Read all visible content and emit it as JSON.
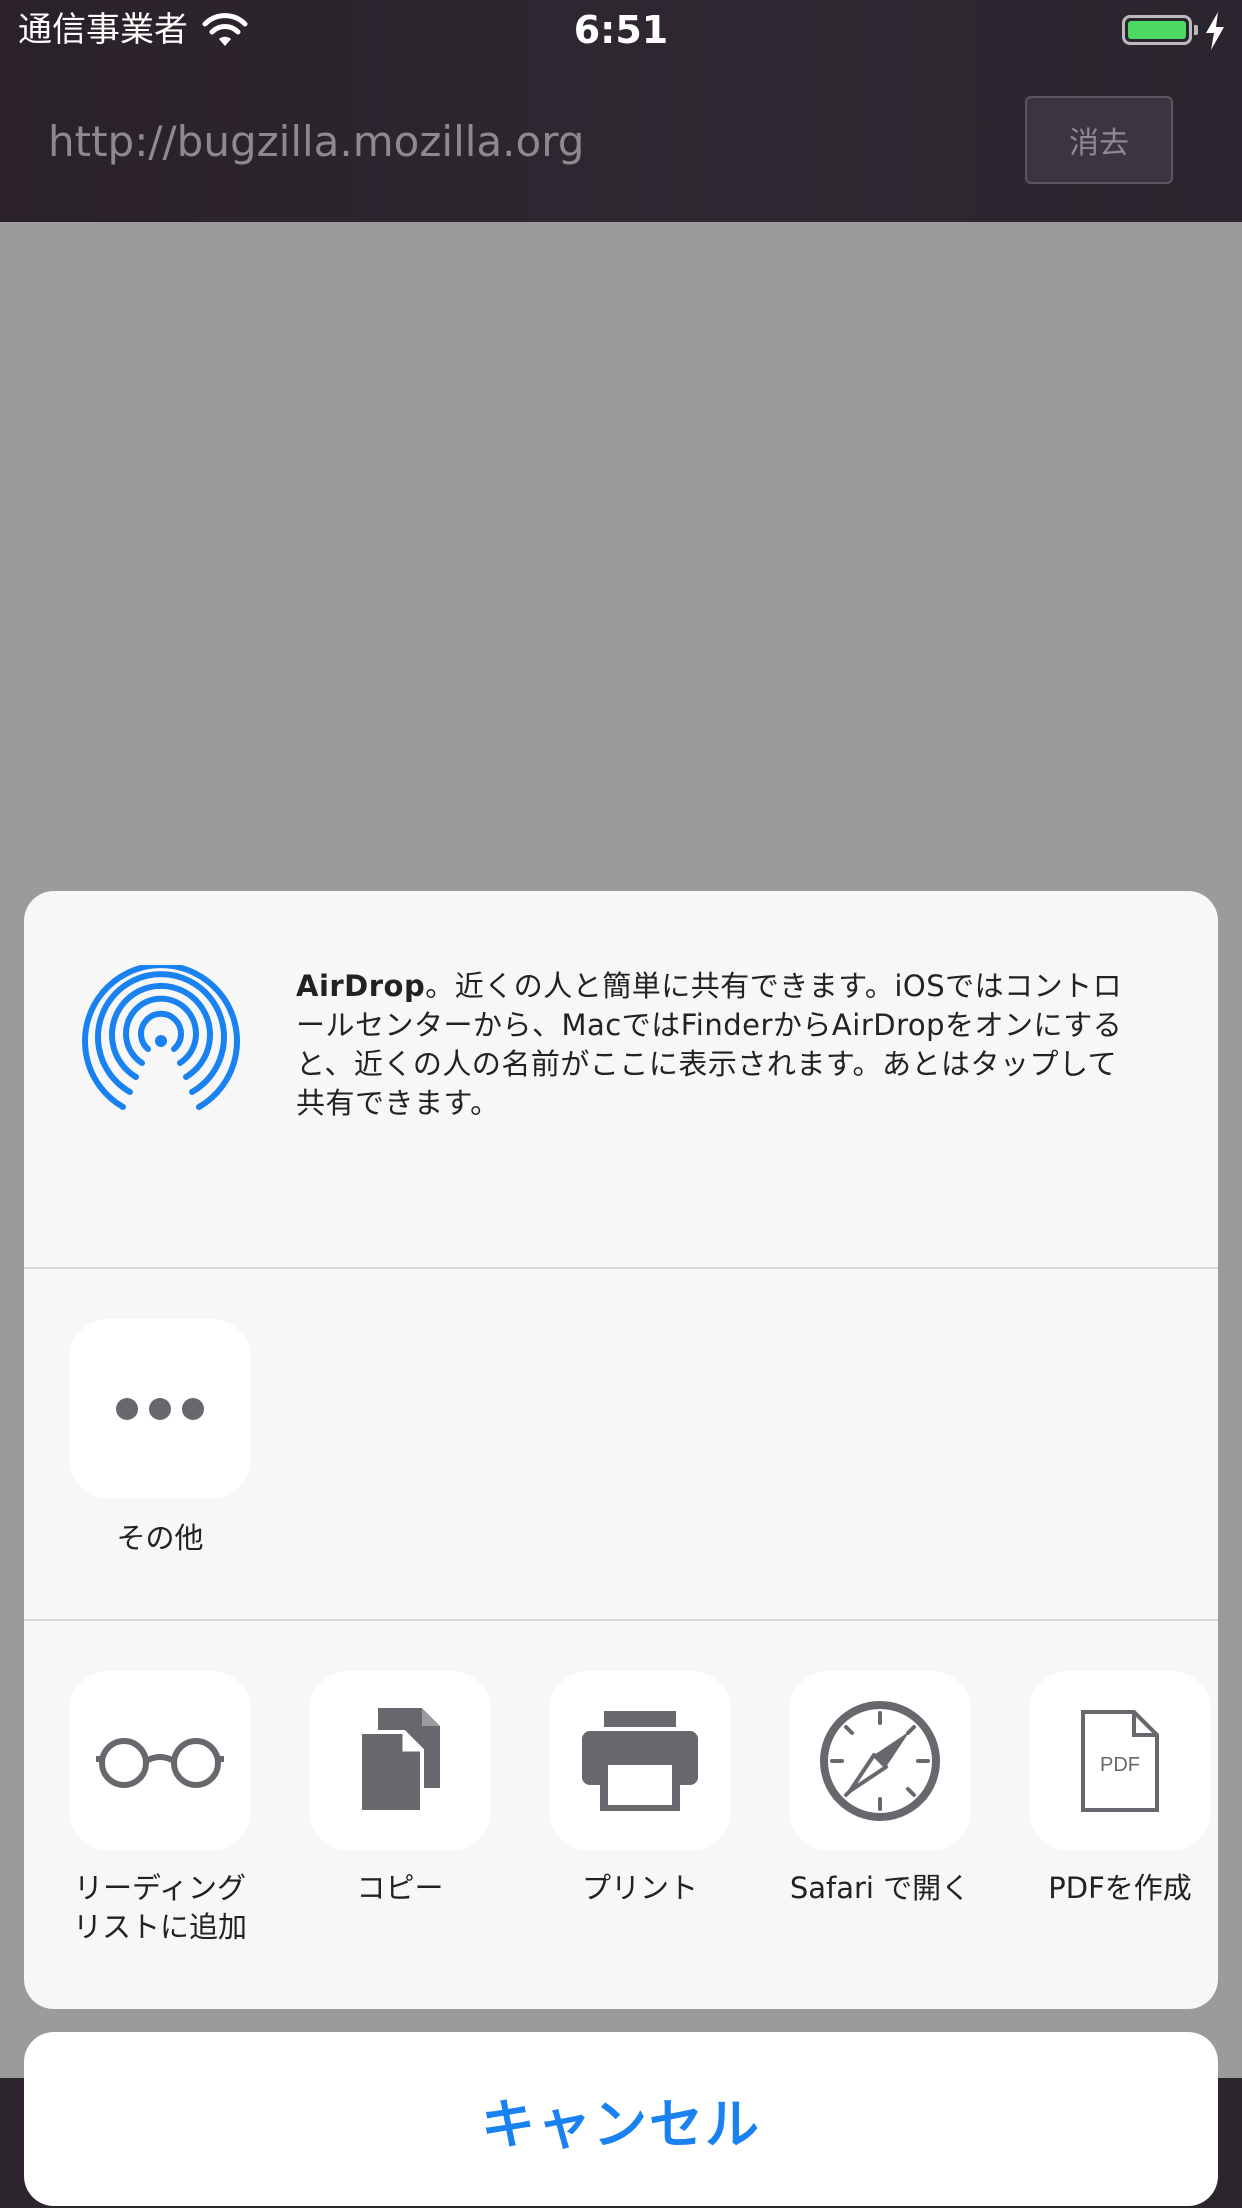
{
  "status_bar": {
    "carrier": "通信事業者",
    "time": "6:51"
  },
  "browser": {
    "url": "http://bugzilla.mozilla.org",
    "clear_label": "消去"
  },
  "share_sheet": {
    "airdrop": {
      "title": "AirDrop",
      "line1": "。近くの人と簡単に共有できます。iOSではコントロ",
      "line2": "ールセンターから、MacではFinderからAirDropをオンにする",
      "line3": "と、近くの人の名前がここに表示されます。あとはタップして",
      "line4": "共有できます。"
    },
    "apps": [
      {
        "label": "その他",
        "icon": "more-icon"
      }
    ],
    "actions": [
      {
        "label_line1": "リーディング",
        "label_line2": "リストに追加",
        "icon": "glasses-icon"
      },
      {
        "label_line1": "コピー",
        "label_line2": "",
        "icon": "copy-icon"
      },
      {
        "label_line1": "プリント",
        "label_line2": "",
        "icon": "print-icon"
      },
      {
        "label_line1": "Safari で開く",
        "label_line2": "",
        "icon": "compass-icon"
      },
      {
        "label_line1": "PDFを作成",
        "label_line2": "",
        "icon": "pdf-icon",
        "icon_text": "PDF"
      }
    ],
    "cancel_label": "キャンセル"
  },
  "colors": {
    "accent": "#1a82f0",
    "airdrop": "#1a82f0",
    "icon_gray": "#68676d",
    "battery": "#4cd964"
  }
}
